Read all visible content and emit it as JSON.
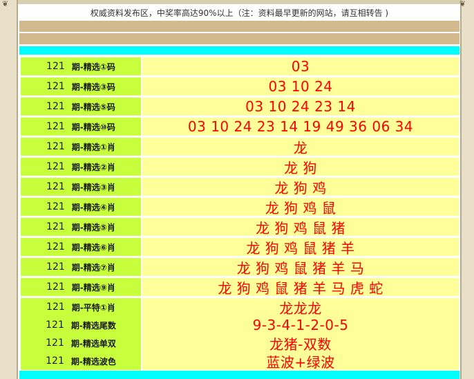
{
  "notice": "权威资料发布区，中奖率高达90%以上（注：资料最早更新的网站，请互相转告 )",
  "rows": [
    {
      "num": "121",
      "label": "期-精选①码",
      "value": "03"
    },
    {
      "num": "121",
      "label": "期-精选③码",
      "value": "03 10 24"
    },
    {
      "num": "121",
      "label": "期-精选⑤码",
      "value": "03 10 24 23 14"
    },
    {
      "num": "121",
      "label": "期-精选⑩码",
      "value": "03 10 24 23 14 19 49 36 06 34"
    },
    {
      "num": "121",
      "label": "期-精选①肖",
      "value": "龙"
    },
    {
      "num": "121",
      "label": "期-精选②肖",
      "value": "龙 狗"
    },
    {
      "num": "121",
      "label": "期-精选③肖",
      "value": "龙 狗 鸡"
    },
    {
      "num": "121",
      "label": "期-精选④肖",
      "value": "龙 狗 鸡 鼠"
    },
    {
      "num": "121",
      "label": "期-精选⑤肖",
      "value": "龙 狗 鸡 鼠 猪"
    },
    {
      "num": "121",
      "label": "期-精选⑥肖",
      "value": "龙 狗 鸡 鼠 猪 羊"
    },
    {
      "num": "121",
      "label": "期-精选⑦肖",
      "value": "龙 狗 鸡 鼠 猪 羊 马"
    },
    {
      "num": "121",
      "label": "期-精选⑨肖",
      "value": "龙 狗 鸡 鼠 猪 羊 马 虎 蛇"
    },
    {
      "num": "121",
      "label": "期-平特①肖",
      "value": "龙龙龙"
    },
    {
      "num": "121",
      "label": "期-精选尾数",
      "value": "9-3-4-1-2-0-5"
    },
    {
      "num": "121",
      "label": "期-精选单双",
      "value": "龙猪-双数"
    },
    {
      "num": "121",
      "label": "期-精选波色",
      "value": "蓝波+绿波"
    }
  ]
}
